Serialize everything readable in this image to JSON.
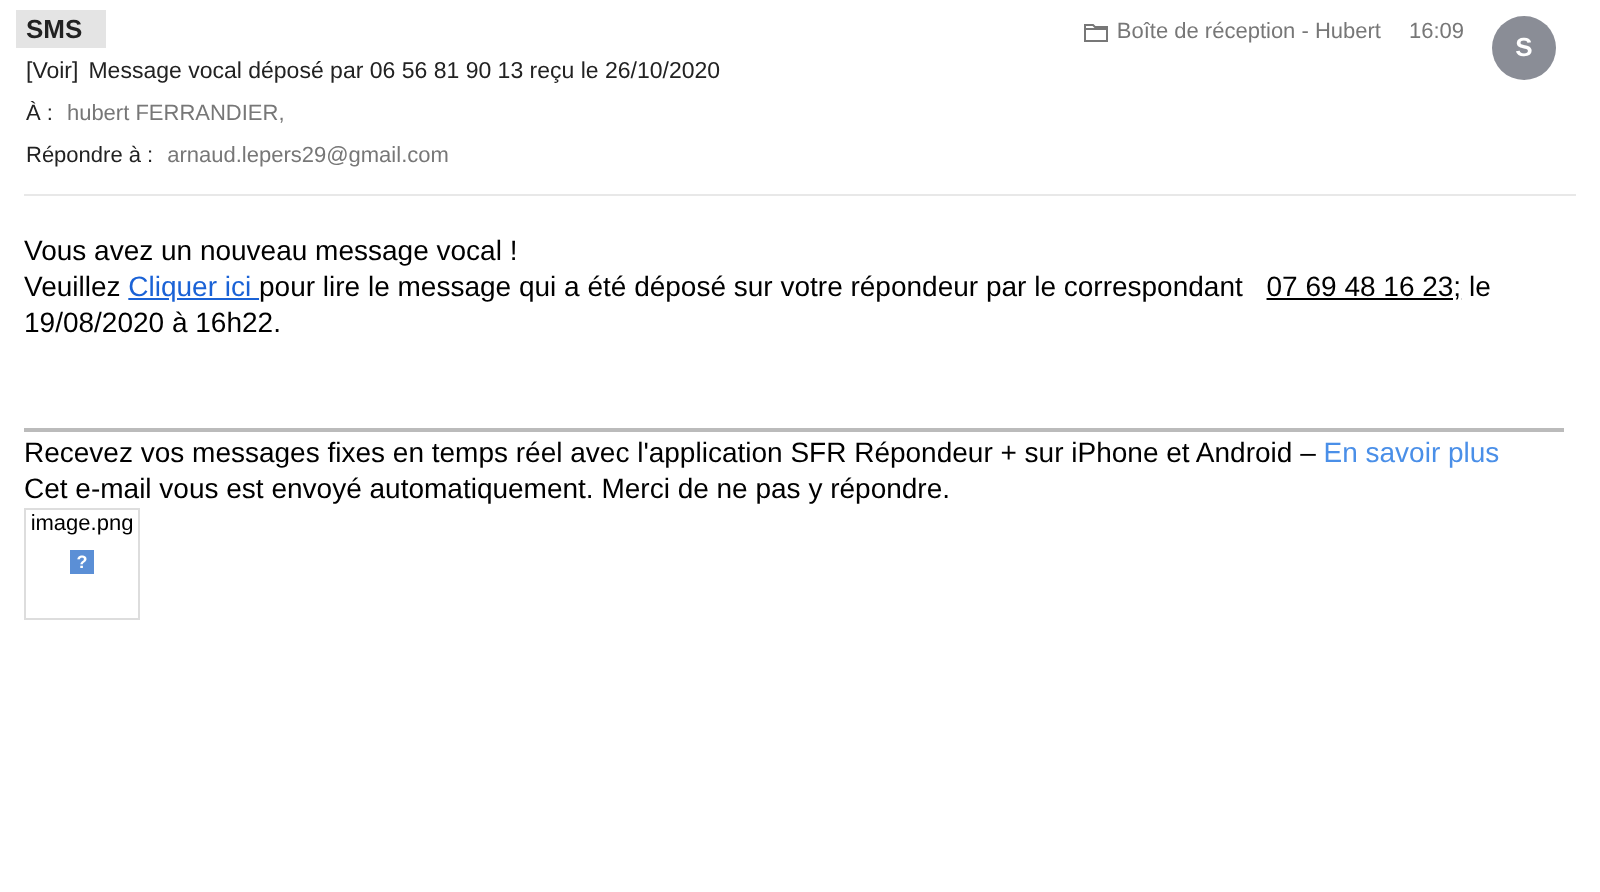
{
  "header": {
    "sender": "SMS",
    "subject_tag": "[Voir]",
    "subject": "Message vocal déposé par 06 56 81 90 13 reçu le 26/10/2020",
    "to_label": "À :",
    "to": "hubert FERRANDIER,",
    "reply_label": "Répondre à :",
    "reply_to": "arnaud.lepers29@gmail.com",
    "folder": "Boîte de réception - Hubert",
    "time": "16:09",
    "avatar": "S"
  },
  "body": {
    "heading": "Vous avez un nouveau message vocal !",
    "intro": "Veuillez ",
    "link": "Cliquer ici ",
    "middle": "pour lire le message qui a été déposé sur votre répondeur par le correspondant ",
    "phone": "07 69 48 16 23;",
    "end": " le 19/08/2020 à 16h22."
  },
  "footer": {
    "promo": "Recevez vos messages fixes en temps réel avec l'application SFR Répondeur + sur iPhone et Android – ",
    "promo_link": "En savoir plus",
    "notice": "Cet e-mail vous est envoyé automatiquement. Merci de ne pas y répondre."
  },
  "attachment": {
    "name": "image.png",
    "icon": "?"
  }
}
